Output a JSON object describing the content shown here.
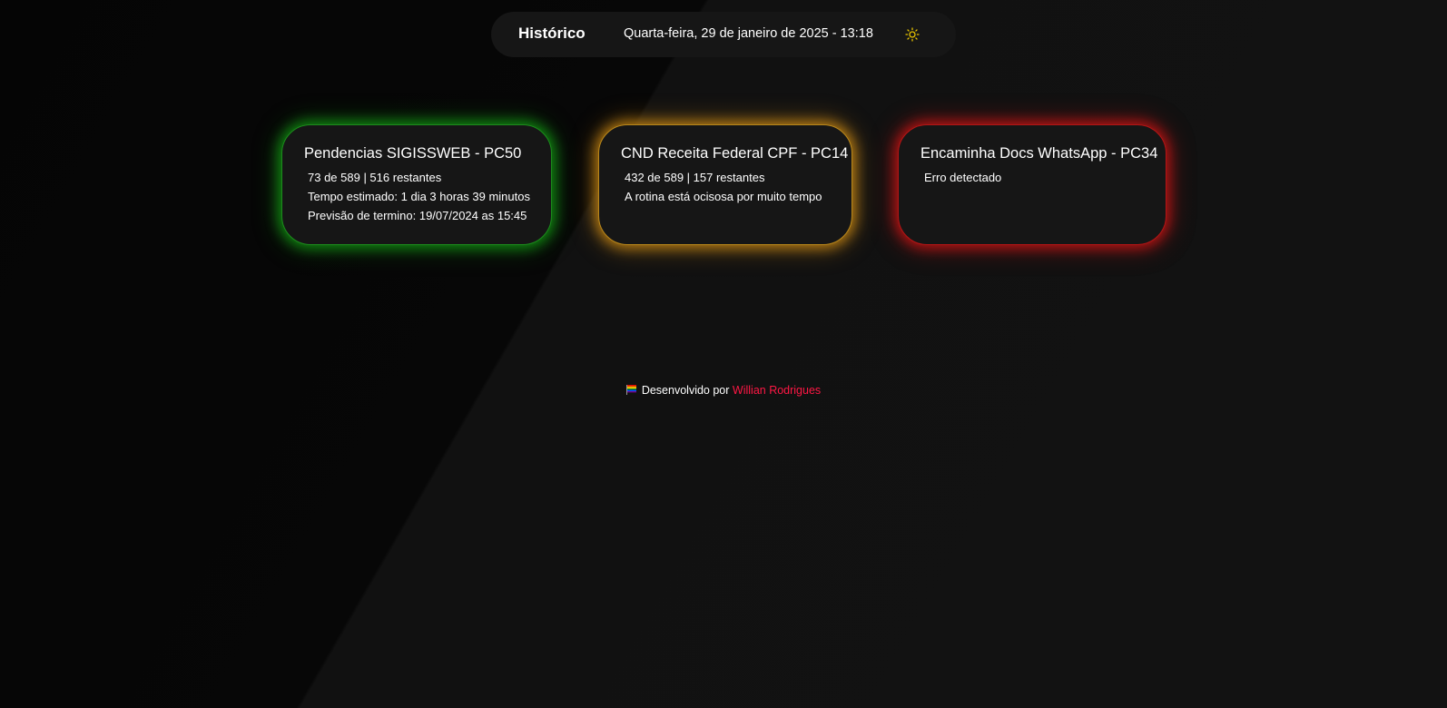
{
  "header": {
    "nav_label": "Histórico",
    "datetime": "Quarta-feira, 29 de janeiro de 2025 - 13:18",
    "theme_icon": "sun-icon"
  },
  "cards": [
    {
      "title": "Pendencias SIGISSWEB - PC50",
      "status_color": "#1c8a1c",
      "lines": [
        "73 de 589 | 516 restantes",
        "Tempo estimado: 1 dia 3 horas 39 minutos",
        "Previsão de termino: 19/07/2024 as 15:45"
      ]
    },
    {
      "title": "CND Receita Federal CPF - PC14",
      "status_color": "#b8861a",
      "lines": [
        "432 de 589 | 157 restantes",
        "A rotina está ocisosa por muito tempo"
      ]
    },
    {
      "title": "Encaminha Docs WhatsApp - PC34",
      "status_color": "#b31515",
      "lines": [
        "Erro detectado"
      ]
    }
  ],
  "footer": {
    "flag_icon": "rainbow-flag-icon",
    "text": "Desenvolvido por",
    "author": "Willian Rodrigues",
    "author_color": "#ff1744"
  }
}
